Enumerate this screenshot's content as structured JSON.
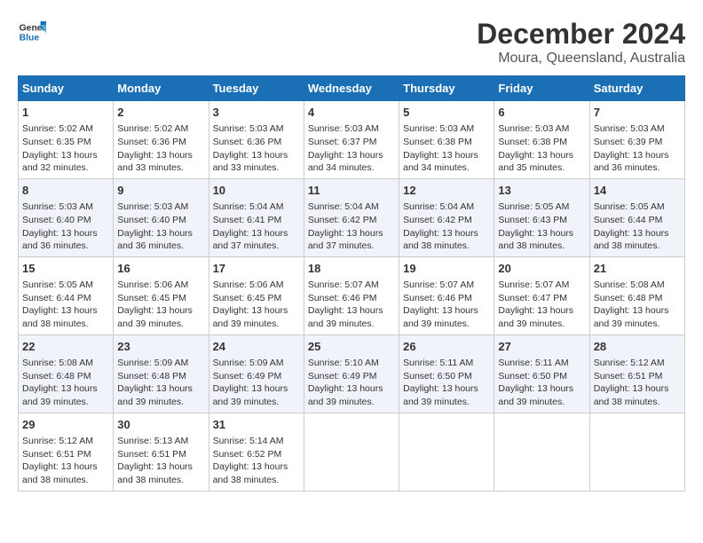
{
  "logo": {
    "line1": "General",
    "line2": "Blue"
  },
  "title": "December 2024",
  "subtitle": "Moura, Queensland, Australia",
  "headers": [
    "Sunday",
    "Monday",
    "Tuesday",
    "Wednesday",
    "Thursday",
    "Friday",
    "Saturday"
  ],
  "weeks": [
    [
      {
        "day": "1",
        "sunrise": "5:02 AM",
        "sunset": "6:35 PM",
        "daylight": "13 hours and 32 minutes."
      },
      {
        "day": "2",
        "sunrise": "5:02 AM",
        "sunset": "6:36 PM",
        "daylight": "13 hours and 33 minutes."
      },
      {
        "day": "3",
        "sunrise": "5:03 AM",
        "sunset": "6:36 PM",
        "daylight": "13 hours and 33 minutes."
      },
      {
        "day": "4",
        "sunrise": "5:03 AM",
        "sunset": "6:37 PM",
        "daylight": "13 hours and 34 minutes."
      },
      {
        "day": "5",
        "sunrise": "5:03 AM",
        "sunset": "6:38 PM",
        "daylight": "13 hours and 34 minutes."
      },
      {
        "day": "6",
        "sunrise": "5:03 AM",
        "sunset": "6:38 PM",
        "daylight": "13 hours and 35 minutes."
      },
      {
        "day": "7",
        "sunrise": "5:03 AM",
        "sunset": "6:39 PM",
        "daylight": "13 hours and 36 minutes."
      }
    ],
    [
      {
        "day": "8",
        "sunrise": "5:03 AM",
        "sunset": "6:40 PM",
        "daylight": "13 hours and 36 minutes."
      },
      {
        "day": "9",
        "sunrise": "5:03 AM",
        "sunset": "6:40 PM",
        "daylight": "13 hours and 36 minutes."
      },
      {
        "day": "10",
        "sunrise": "5:04 AM",
        "sunset": "6:41 PM",
        "daylight": "13 hours and 37 minutes."
      },
      {
        "day": "11",
        "sunrise": "5:04 AM",
        "sunset": "6:42 PM",
        "daylight": "13 hours and 37 minutes."
      },
      {
        "day": "12",
        "sunrise": "5:04 AM",
        "sunset": "6:42 PM",
        "daylight": "13 hours and 38 minutes."
      },
      {
        "day": "13",
        "sunrise": "5:05 AM",
        "sunset": "6:43 PM",
        "daylight": "13 hours and 38 minutes."
      },
      {
        "day": "14",
        "sunrise": "5:05 AM",
        "sunset": "6:44 PM",
        "daylight": "13 hours and 38 minutes."
      }
    ],
    [
      {
        "day": "15",
        "sunrise": "5:05 AM",
        "sunset": "6:44 PM",
        "daylight": "13 hours and 38 minutes."
      },
      {
        "day": "16",
        "sunrise": "5:06 AM",
        "sunset": "6:45 PM",
        "daylight": "13 hours and 39 minutes."
      },
      {
        "day": "17",
        "sunrise": "5:06 AM",
        "sunset": "6:45 PM",
        "daylight": "13 hours and 39 minutes."
      },
      {
        "day": "18",
        "sunrise": "5:07 AM",
        "sunset": "6:46 PM",
        "daylight": "13 hours and 39 minutes."
      },
      {
        "day": "19",
        "sunrise": "5:07 AM",
        "sunset": "6:46 PM",
        "daylight": "13 hours and 39 minutes."
      },
      {
        "day": "20",
        "sunrise": "5:07 AM",
        "sunset": "6:47 PM",
        "daylight": "13 hours and 39 minutes."
      },
      {
        "day": "21",
        "sunrise": "5:08 AM",
        "sunset": "6:48 PM",
        "daylight": "13 hours and 39 minutes."
      }
    ],
    [
      {
        "day": "22",
        "sunrise": "5:08 AM",
        "sunset": "6:48 PM",
        "daylight": "13 hours and 39 minutes."
      },
      {
        "day": "23",
        "sunrise": "5:09 AM",
        "sunset": "6:48 PM",
        "daylight": "13 hours and 39 minutes."
      },
      {
        "day": "24",
        "sunrise": "5:09 AM",
        "sunset": "6:49 PM",
        "daylight": "13 hours and 39 minutes."
      },
      {
        "day": "25",
        "sunrise": "5:10 AM",
        "sunset": "6:49 PM",
        "daylight": "13 hours and 39 minutes."
      },
      {
        "day": "26",
        "sunrise": "5:11 AM",
        "sunset": "6:50 PM",
        "daylight": "13 hours and 39 minutes."
      },
      {
        "day": "27",
        "sunrise": "5:11 AM",
        "sunset": "6:50 PM",
        "daylight": "13 hours and 39 minutes."
      },
      {
        "day": "28",
        "sunrise": "5:12 AM",
        "sunset": "6:51 PM",
        "daylight": "13 hours and 38 minutes."
      }
    ],
    [
      {
        "day": "29",
        "sunrise": "5:12 AM",
        "sunset": "6:51 PM",
        "daylight": "13 hours and 38 minutes."
      },
      {
        "day": "30",
        "sunrise": "5:13 AM",
        "sunset": "6:51 PM",
        "daylight": "13 hours and 38 minutes."
      },
      {
        "day": "31",
        "sunrise": "5:14 AM",
        "sunset": "6:52 PM",
        "daylight": "13 hours and 38 minutes."
      },
      null,
      null,
      null,
      null
    ]
  ],
  "labels": {
    "sunrise": "Sunrise:",
    "sunset": "Sunset:",
    "daylight": "Daylight:"
  }
}
